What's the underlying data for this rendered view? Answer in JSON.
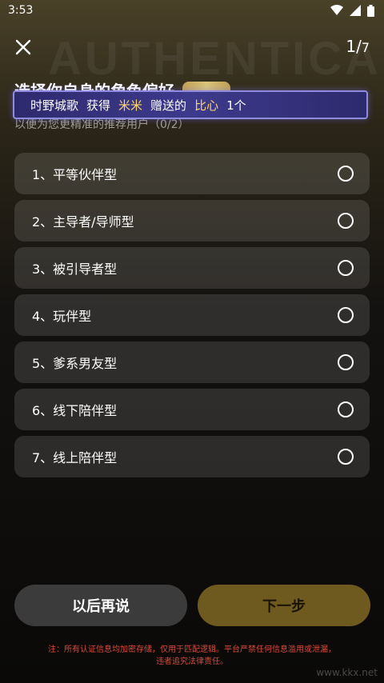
{
  "status_bar": {
    "time": "3:53"
  },
  "header": {
    "watermark": "AUTHENTICA",
    "page_current": "1/",
    "page_total": "7",
    "title": "选择你自身的角色偏好",
    "subtitle": "以便为您更精准的推荐用户（0/2）"
  },
  "banner": {
    "sender": "时野城歌",
    "verb": "获得",
    "receiver": "米米",
    "action": "赠送的",
    "gift": "比心",
    "count": "1个"
  },
  "options": [
    {
      "label": "1、平等伙伴型"
    },
    {
      "label": "2、主导者/导师型"
    },
    {
      "label": "3、被引导者型"
    },
    {
      "label": "4、玩伴型"
    },
    {
      "label": "5、爹系男友型"
    },
    {
      "label": "6、线下陪伴型"
    },
    {
      "label": "7、线上陪伴型"
    }
  ],
  "buttons": {
    "later": "以后再说",
    "next": "下一步"
  },
  "notice": {
    "line1": "注：所有认证信息均加密存储，仅用于匹配逻辑。平台严禁任何信息滥用或泄漏，",
    "line2": "违者追究法律责任。"
  },
  "corner_logo": "www.kkx.net",
  "colors": {
    "accent": "#6e5a1e",
    "banner_bg": "#3d3a8c",
    "notice": "#d94a3a"
  }
}
